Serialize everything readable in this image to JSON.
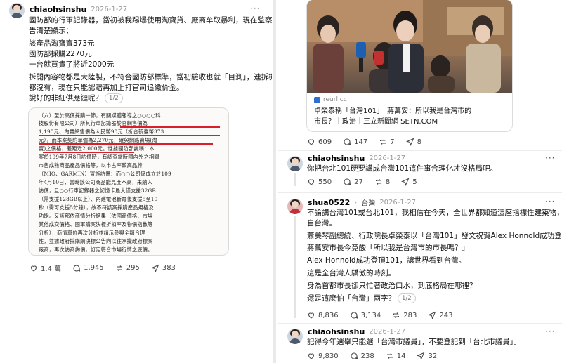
{
  "left_post": {
    "username": "chiaohsinshu",
    "date": "2026-1-27",
    "more": "···",
    "lines": [
      "國防部的行軍記錄器，當初被我踢爆使用淘寶貨、廠商牟取暴利，現在監察院的報",
      "告清楚顯示：",
      "",
      "該產品淘寶賣373元",
      "國防部採購2270元",
      "一台就買貴了將近2000元",
      "",
      "拆開內容物都是大陸製，不符合國防部標準，當初驗收也就「目測」，連拆機檢查",
      "都沒有，現在只能認賠再加上打官司追繳价金。",
      "",
      "說好的非紅供應鏈呢？"
    ],
    "page_indicator": "1/2",
    "doc_lines": [
      "（六）至於高價採購一節，有關媒體報導之○○○○科",
      "   技股份有限公司）所其行車記錄器於官網售價為",
      "   1,190元、淘寶網售價為人民幣90元（折合新臺幣373",
      "   元），而本案契約單價為2,270元，確與網路賣場(淘",
      "   寶)之價格，差距近2,000元。惟據國防部說稱：本",
      "   案於109年7月8日訪價時，有調查當時國內外之相關",
      "   市售成熟商品產品價格等，以市占率較高品牌",
      "   （MIO、GARMIN）實施訪價：而○○公司係成立於109",
      "   年4月10日，當時該公司商品能見度不高，未納入",
      "   訪價，且○○行車記錄器之記憶卡最大僅支援32GB",
      "   （需支援128GB以上）、內建電池斷電後支援5至10",
      "   秒（需可支援5分鐘），故不符該案採購產品規格及",
      "   功能。又該部依商情分析結果（依國商價格、市場",
      "   其他成交價格、國軍購案決標折扣率及物價指數等",
      "   分析），商情單位再次分析並請示參與全額合理",
      "   性，並據政府採購網決標公告向以往承攬政府標案",
      "   廠商，再次訪商詢價，訂定符合市場行情之底價。"
    ],
    "actions": {
      "likes": "1.4 萬",
      "comments": "1,945",
      "reposts": "295",
      "shares": "383"
    }
  },
  "right_top": {
    "card_source": "reurl.cc",
    "card_title_1": "卓榮泰稱「台灣101」　蔣萬安：所以我是台灣市的",
    "card_title_2": "市長？｜政治｜三立新聞網 SETN.COM",
    "actions": {
      "likes": "609",
      "comments": "147",
      "reposts": "7",
      "shares": "8"
    }
  },
  "reply1": {
    "username": "chiaohsinshu",
    "date": "2026-1-27",
    "more": "···",
    "text": "你把台北101硬要講成台灣101這件事合理化才沒格局吧。",
    "actions": {
      "likes": "550",
      "comments": "27",
      "reposts": "8",
      "shares": "5"
    }
  },
  "reply2": {
    "username": "shua0522",
    "topic": "台灣",
    "date": "2026-1-27",
    "more": "···",
    "lines": [
      "不論講台灣101或台北101，我相信在今天，全世界都知道這座指標性建築物，來",
      "自台灣。",
      "",
      "蕭美琴副總統、行政院長卓榮泰以「台灣101」發文祝賀Alex Honnold成功登頂，",
      "蔣萬安市長今竟酸「所以我是台灣市的市長嗎？」",
      "",
      "Alex Honnold成功登頂101，讓世界看到台灣。",
      "",
      "這是全台灣人驕傲的時刻。",
      "",
      "身為首都市長卻只忙著政治口水，到底格局在哪裡？",
      "",
      "還是這麼怕「台灣」兩字？"
    ],
    "page_indicator": "1/2",
    "actions": {
      "likes": "8,836",
      "comments": "3,134",
      "reposts": "283",
      "shares": "243"
    }
  },
  "reply3": {
    "username": "chiaohsinshu",
    "date": "2026-1-27",
    "more": "···",
    "text": "記得今年選舉只能選「台灣市議員」，不要登記到「台北市議員」。",
    "actions": {
      "likes": "9,830",
      "comments": "238",
      "reposts": "14",
      "shares": "32"
    }
  },
  "colors": {
    "highlight_red": "#d8202a",
    "muted": "#9a9a9a",
    "divider": "#e9e9e9"
  },
  "icons": [
    "heart-icon",
    "comment-icon",
    "repost-icon",
    "share-icon",
    "more-icon",
    "link-icon"
  ]
}
